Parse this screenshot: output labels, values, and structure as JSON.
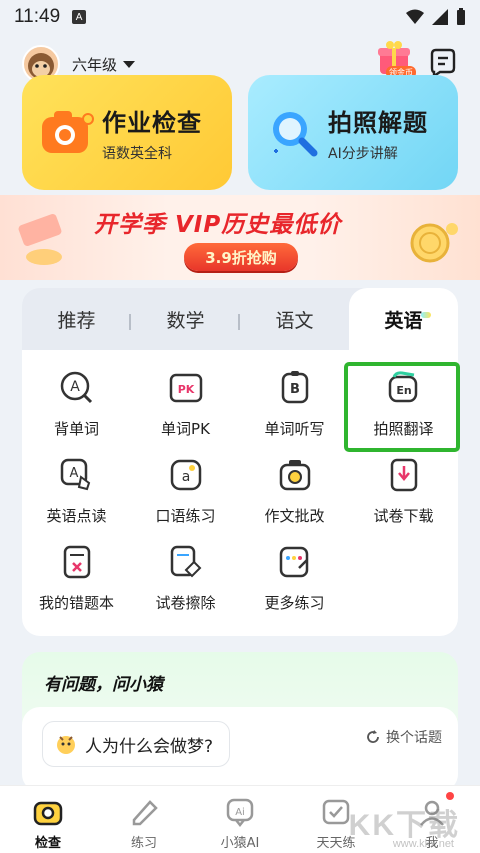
{
  "status": {
    "time": "11:49",
    "a": "A"
  },
  "header": {
    "grade": "六年级",
    "gift_label": "领金币"
  },
  "cards": [
    {
      "title": "作业检查",
      "subtitle": "语数英全科"
    },
    {
      "title": "拍照解题",
      "subtitle": "AI分步讲解"
    }
  ],
  "banner": {
    "headline": "开学季 VIP历史最低价",
    "cta": "3.9折抢购"
  },
  "subjects": {
    "tabs": [
      "推荐",
      "数学",
      "语文",
      "英语"
    ],
    "active": "英语"
  },
  "tools": [
    {
      "label": "背单词",
      "icon": "A"
    },
    {
      "label": "单词PK",
      "icon": "PK"
    },
    {
      "label": "单词听写",
      "icon": "B"
    },
    {
      "label": "拍照翻译",
      "icon": "En"
    },
    {
      "label": "英语点读",
      "icon": "A"
    },
    {
      "label": "口语练习",
      "icon": "a"
    },
    {
      "label": "作文批改",
      "icon": ""
    },
    {
      "label": "试卷下载",
      "icon": ""
    },
    {
      "label": "我的错题本",
      "icon": ""
    },
    {
      "label": "试卷擦除",
      "icon": ""
    },
    {
      "label": "更多练习",
      "icon": ""
    }
  ],
  "ask": {
    "heading": "有问题，问小猿",
    "question": "人为什么会做梦?",
    "swap": "换个话题"
  },
  "nav": [
    "检查",
    "练习",
    "小猿AI",
    "天天练",
    "我"
  ],
  "watermark": {
    "big": "KK下载",
    "small": "www.kkx.net"
  },
  "colors": {
    "highlight": "#2fb52f",
    "card_yellow": "#ffd23f",
    "card_blue": "#7fd9f5",
    "accent_red": "#e8262b"
  }
}
